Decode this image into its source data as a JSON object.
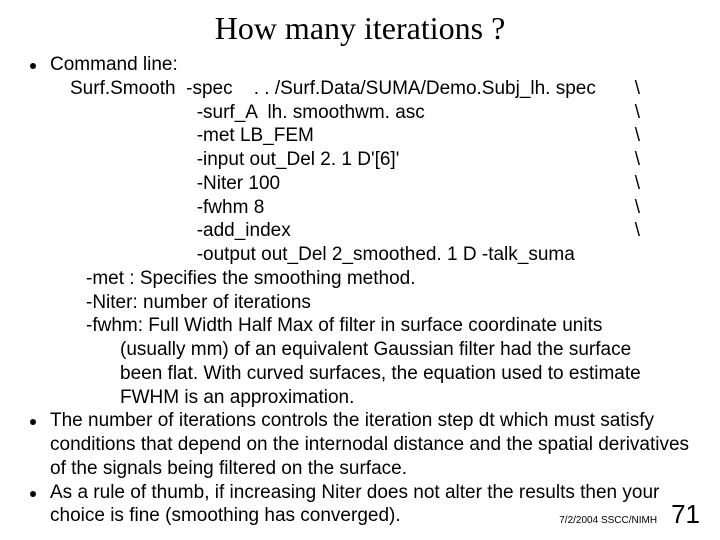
{
  "title": "How many iterations ?",
  "bullet1_label": "Command line:",
  "cmd": {
    "l1": "Surf.Smooth  -spec    . . /Surf.Data/SUMA/Demo.Subj_lh. spec",
    "l2": "                        -surf_A  lh. smoothwm. asc",
    "l3": "                        -met LB_FEM",
    "l4": "                        -input out_Del 2. 1 D'[6]'",
    "l5": "                        -Niter 100",
    "l6": "                        -fwhm 8",
    "l7": "                        -add_index",
    "l8": "                        -output out_Del 2_smoothed. 1 D -talk_suma",
    "slash": "\\"
  },
  "desc": {
    "met": "-met : Specifies the smoothing method.",
    "niter": "-Niter: number of iterations",
    "fwhm1": "-fwhm: Full Width Half Max of filter in surface coordinate units",
    "fwhm2": "(usually mm) of an equivalent Gaussian filter had the surface",
    "fwhm3": "been flat. With curved surfaces, the equation used to estimate",
    "fwhm4": "FWHM is an approximation."
  },
  "bullet2": "The number of iterations controls the iteration step dt which must satisfy conditions that depend on the internodal distance and the spatial derivatives of the signals being filtered on the surface.",
  "bullet3": "As a rule of thumb, if increasing Niter does not alter the results then your choice is fine (smoothing has converged).",
  "footer_date": "7/2/2004 SSCC/NIMH",
  "page_num": "71"
}
